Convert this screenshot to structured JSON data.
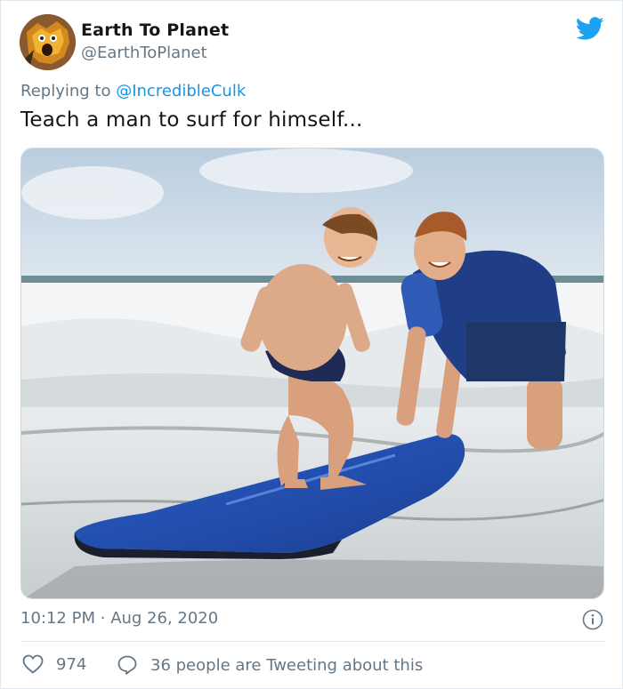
{
  "tweet": {
    "author_name": "Earth To Planet",
    "author_handle": "@EarthToPlanet",
    "reply_prefix": "Replying to",
    "reply_to": "@IncredibleCulk",
    "text": "Teach a man to surf for himself...",
    "time": "10:12 PM",
    "separator": "·",
    "date": "Aug 26, 2020"
  },
  "stats": {
    "likes": "974",
    "conversation": "36 people are Tweeting about this"
  },
  "icons": {
    "logo": "twitter-bird-icon",
    "info": "info-icon",
    "like": "heart-icon",
    "reply": "speech-bubble-icon"
  },
  "colors": {
    "twitter_blue": "#1da1f2",
    "link_blue": "#1b95e0",
    "secondary_text": "#657786",
    "primary_text": "#14171a",
    "border": "#e1e8ed"
  }
}
